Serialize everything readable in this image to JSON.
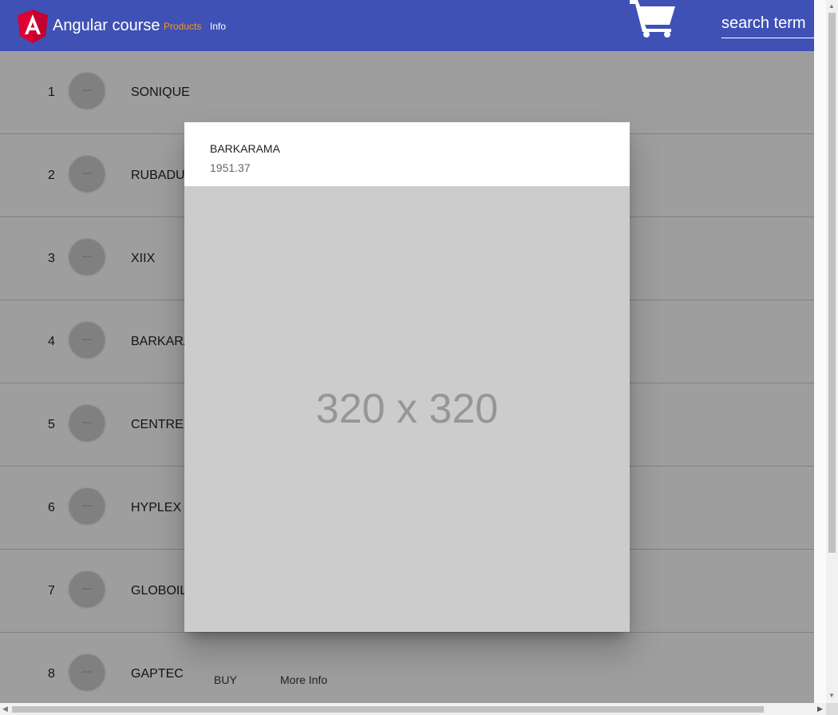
{
  "header": {
    "title": "Angular course",
    "nav": [
      {
        "label": "Products",
        "active": true
      },
      {
        "label": "Info",
        "active": false
      }
    ],
    "search_placeholder": "search term",
    "cart_icon": "shopping-cart-icon",
    "logo_icon": "angular-logo-icon",
    "colors": {
      "toolbar": "#3f51b5",
      "active_link": "#ff9800"
    }
  },
  "products": [
    {
      "num": "1",
      "name": "SONIQUE"
    },
    {
      "num": "2",
      "name": "RUBADUB"
    },
    {
      "num": "3",
      "name": "XIIX"
    },
    {
      "num": "4",
      "name": "BARKARAMA"
    },
    {
      "num": "5",
      "name": "CENTREXIN"
    },
    {
      "num": "6",
      "name": "HYPLEX"
    },
    {
      "num": "7",
      "name": "GLOBOIL"
    },
    {
      "num": "8",
      "name": "GAPTEC"
    }
  ],
  "dialog": {
    "title": "BARKARAMA",
    "price": "1951.37",
    "image_placeholder": "320 x 320"
  },
  "actions": {
    "buy": "BUY",
    "more_info": "More Info"
  }
}
